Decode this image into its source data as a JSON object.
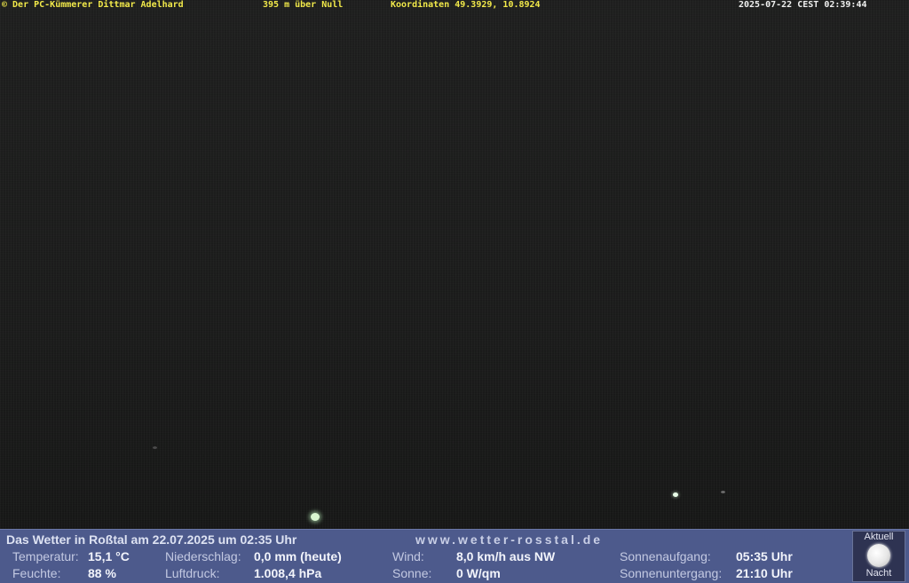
{
  "header": {
    "copyright": "© Der PC-Kümmerer Dittmar Adelhard",
    "altitude": "395 m über Null",
    "coordinates": "Koordinaten 49.3929, 10.8924",
    "datetime": "2025-07-22 CEST 02:39:44"
  },
  "weather": {
    "headline": "Das Wetter in Roßtal am 22.07.2025 um 02:35 Uhr",
    "website": "www.wetter-rosstal.de",
    "temperature_label": "Temperatur:",
    "temperature_value": "15,1 °C",
    "humidity_label": "Feuchte:",
    "humidity_value": "88 %",
    "precip_label": "Niederschlag:",
    "precip_value": "0,0 mm (heute)",
    "pressure_label": "Luftdruck:",
    "pressure_value": "1.008,4 hPa",
    "wind_label": "Wind:",
    "wind_value": "8,0 km/h aus NW",
    "sun_label": "Sonne:",
    "sun_value": "0 W/qm",
    "sunrise_label": "Sonnenaufgang:",
    "sunrise_value": "05:35 Uhr",
    "sunset_label": "Sonnenuntergang:",
    "sunset_value": "21:10 Uhr"
  },
  "moon": {
    "top_label": "Aktuell",
    "bottom_label": "Nacht",
    "icon": "full-moon-icon"
  },
  "colors": {
    "overlay_text": "#f2e94a",
    "panel_bg": "#4d5a8c"
  }
}
